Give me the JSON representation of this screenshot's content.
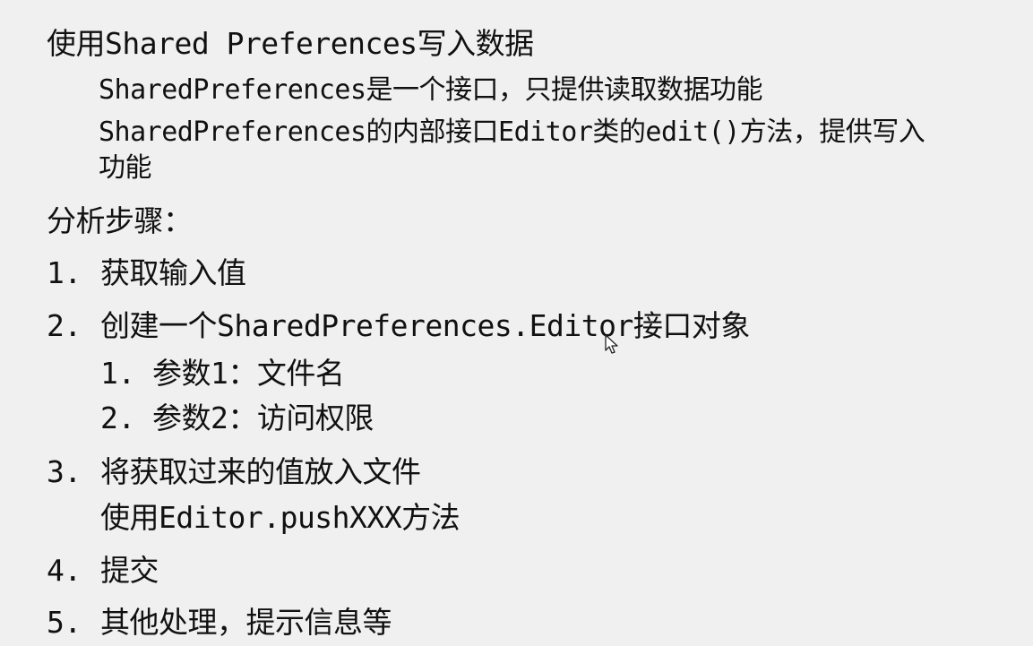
{
  "heading": "使用Shared Preferences写入数据",
  "intro": [
    "SharedPreferences是一个接口，只提供读取数据功能",
    "SharedPreferences的内部接口Editor类的edit()方法，提供写入",
    "功能"
  ],
  "steps_title": "分析步骤：",
  "steps": [
    {
      "num": "1.",
      "text": "获取输入值"
    },
    {
      "num": "2.",
      "text": "创建一个SharedPreferences.Editor接口对象"
    },
    {
      "num": "3.",
      "text": "将获取过来的值放入文件"
    },
    {
      "num": "4.",
      "text": "提交"
    },
    {
      "num": "5.",
      "text": "其他处理，提示信息等"
    }
  ],
  "substeps": [
    {
      "num": "1.",
      "text": "参数1：文件名"
    },
    {
      "num": "2.",
      "text": "参数2：访问权限"
    }
  ],
  "step3_detail": "使用Editor.pushXXX方法",
  "colors": {
    "background": "#f0f0f0",
    "text": "#111111"
  },
  "cursor_icon": "mouse-pointer-icon"
}
